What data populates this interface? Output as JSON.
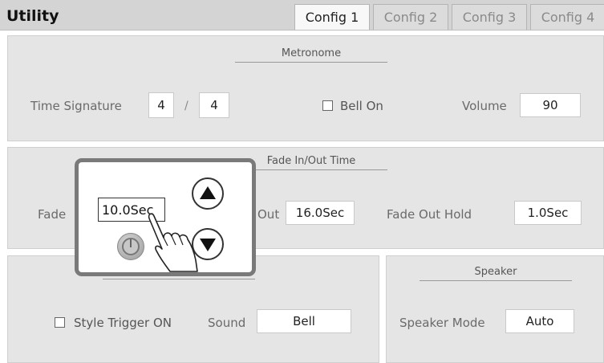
{
  "header": {
    "title": "Utility",
    "tabs": [
      "Config 1",
      "Config 2",
      "Config 3",
      "Config 4"
    ],
    "active_tab": "Config 1"
  },
  "metronome": {
    "title": "Metronome",
    "time_signature_label": "Time Signature",
    "numerator": "4",
    "separator": "/",
    "denominator": "4",
    "bell_label": "Bell On",
    "bell_checked": false,
    "volume_label": "Volume",
    "volume_value": "90"
  },
  "fade": {
    "title": "Fade In/Out Time",
    "fade_in_label": "Fade",
    "fade_out_label": "Out",
    "fade_out_value": "16.0Sec",
    "fade_out_hold_label": "Fade Out Hold",
    "fade_out_hold_value": "1.0Sec"
  },
  "popup": {
    "value": "10.0Sec",
    "up_icon": "triangle-up-icon",
    "down_icon": "triangle-down-icon",
    "knob_icon": "power-knob-icon",
    "hand_icon": "pointing-hand-icon"
  },
  "style_section": {
    "style_trigger_label": "Style Trigger ON",
    "style_trigger_checked": false,
    "sound_label": "Sound",
    "sound_value": "Bell"
  },
  "speaker": {
    "title": "Speaker",
    "mode_label": "Speaker Mode",
    "mode_value": "Auto"
  }
}
